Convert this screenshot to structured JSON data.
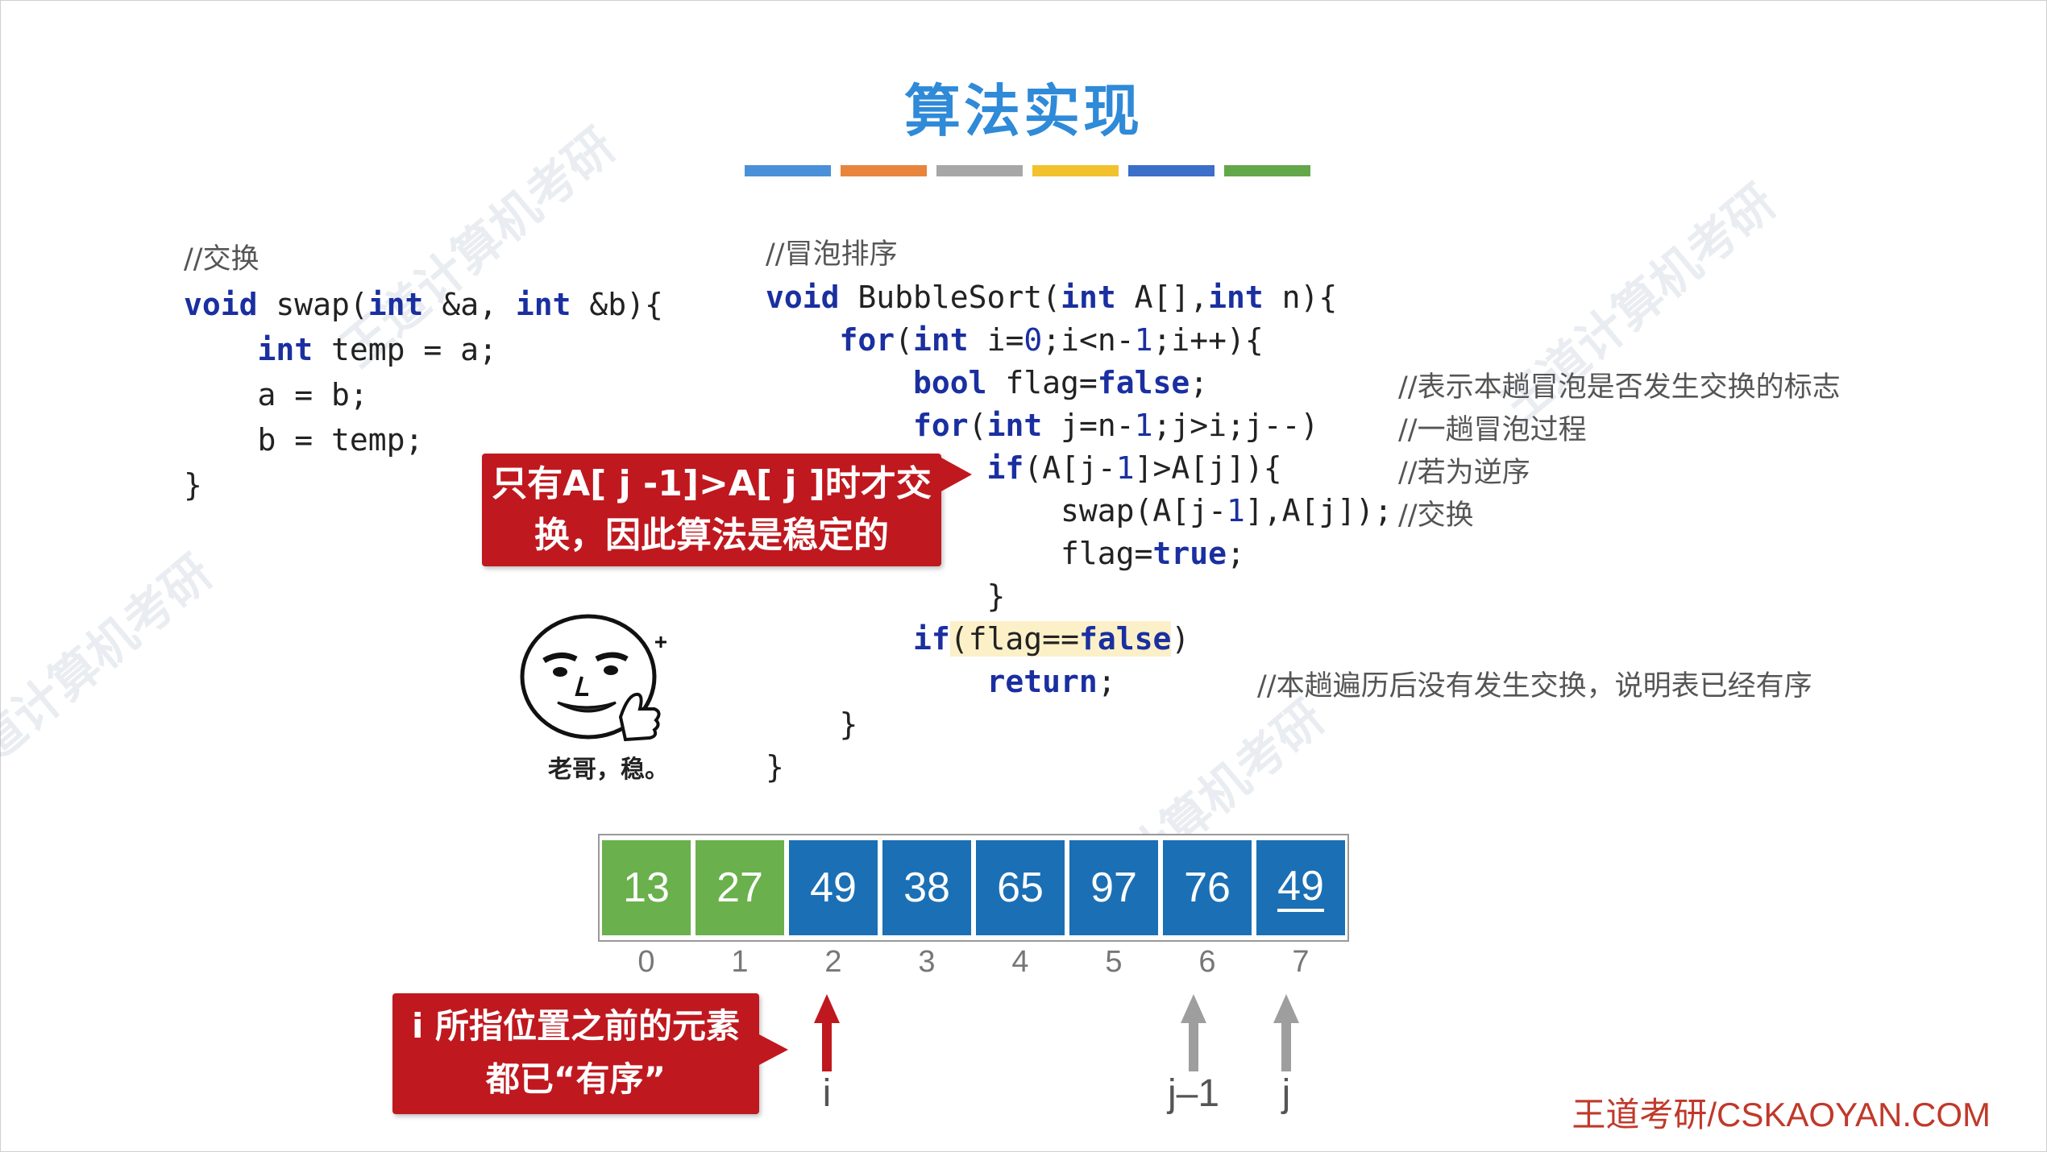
{
  "title": "算法实现",
  "color_bar": [
    "#4a90d9",
    "#e8843c",
    "#a7a7a7",
    "#f2c12e",
    "#3b6fc9",
    "#62a84a"
  ],
  "swap_code": {
    "comment": "//交换",
    "line1_kw1": "void",
    "line1_rest1": " swap(",
    "line1_kw2": "int",
    "line1_rest2": " &a, ",
    "line1_kw3": "int",
    "line1_rest3": " &b){",
    "line2_kw": "int",
    "line2_rest": " temp = a;",
    "line3": "a = b;",
    "line4": "b = temp;",
    "line5": "}"
  },
  "bubble_code": {
    "comment": "//冒泡排序",
    "l1_kw1": "void",
    "l1_r1": " BubbleSort(",
    "l1_kw2": "int",
    "l1_r2": " A[],",
    "l1_kw3": "int",
    "l1_r3": " n){",
    "l2_kw1": "for",
    "l2_r1": "(",
    "l2_kw2": "int",
    "l2_r2": " i=",
    "l2_n1": "0",
    "l2_r3": ";i<n-",
    "l2_n2": "1",
    "l2_r4": ";i++){",
    "l3_kw1": "bool",
    "l3_r1": " flag=",
    "l3_kw2": "false",
    "l3_r2": ";",
    "l4_kw1": "for",
    "l4_r1": "(",
    "l4_kw2": "int",
    "l4_r2": " j=n-",
    "l4_n1": "1",
    "l4_r3": ";j>i;j--)",
    "l5_kw1": "if",
    "l5_r1": "(A[j-",
    "l5_n1": "1",
    "l5_r2": "]>A[j]){",
    "l6_r1": "swap(A[j-",
    "l6_n1": "1",
    "l6_r2": "],A[j]);",
    "l7_r1": "flag=",
    "l7_kw1": "true",
    "l7_r2": ";",
    "l8": "}",
    "l9_kw1": "if",
    "l9_r1": "(flag==",
    "l9_kw2": "false",
    "l9_r2": ")",
    "l10_kw1": "return",
    "l10_r1": ";",
    "l11": "}",
    "l12": "}"
  },
  "comments": {
    "flag": "//表示本趟冒泡是否发生交换的标志",
    "pass": "//一趟冒泡过程",
    "reverse": "//若为逆序",
    "swap": "//交换",
    "noswap": "//本趟遍历后没有发生交换，说明表已经有序"
  },
  "callout_stable": {
    "line1": "只有A[ j -1]>A[ j ]时才交",
    "line2": "换，因此算法是稳定的"
  },
  "callout_sorted": {
    "line1": "i 所指位置之前的元素",
    "line2": "都已“有序”"
  },
  "emoji_caption": "老哥，稳。",
  "array": {
    "values": [
      "13",
      "27",
      "49",
      "38",
      "65",
      "97",
      "76",
      "49"
    ],
    "colors": [
      "green",
      "green",
      "blue",
      "blue",
      "blue",
      "blue",
      "blue",
      "blue"
    ],
    "indices": [
      "0",
      "1",
      "2",
      "3",
      "4",
      "5",
      "6",
      "7"
    ]
  },
  "pointers": {
    "i": "i",
    "j_minus_1": "j–1",
    "j": "j",
    "i_color": "#c0181f",
    "j_color": "#9e9e9e"
  },
  "footer": "王道考研/CSKAOYAN.COM",
  "watermark": "王道计算机考研"
}
